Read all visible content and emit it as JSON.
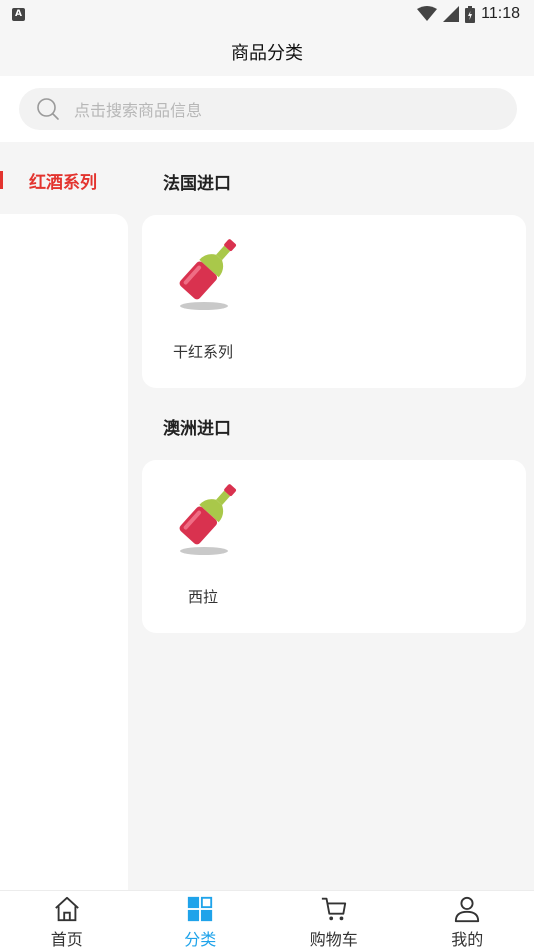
{
  "status_bar": {
    "time": "11:18",
    "badge": "A"
  },
  "header": {
    "title": "商品分类"
  },
  "search": {
    "placeholder": "点击搜索商品信息"
  },
  "sidebar": {
    "items": [
      {
        "label": "红酒系列",
        "active": true
      }
    ]
  },
  "sections": [
    {
      "title": "法国进口",
      "products": [
        {
          "name": "干红系列",
          "icon": "wine-bottle-icon"
        }
      ]
    },
    {
      "title": "澳洲进口",
      "products": [
        {
          "name": "西拉",
          "icon": "wine-bottle-icon"
        }
      ]
    }
  ],
  "tabbar": {
    "items": [
      {
        "label": "首页",
        "icon": "home-icon"
      },
      {
        "label": "分类",
        "icon": "category-grid-icon",
        "active": true
      },
      {
        "label": "购物车",
        "icon": "cart-icon"
      },
      {
        "label": "我的",
        "icon": "user-icon"
      }
    ]
  },
  "colors": {
    "accent_red": "#e3342f",
    "accent_blue": "#1fa3ea",
    "background": "#f5f5f5"
  }
}
